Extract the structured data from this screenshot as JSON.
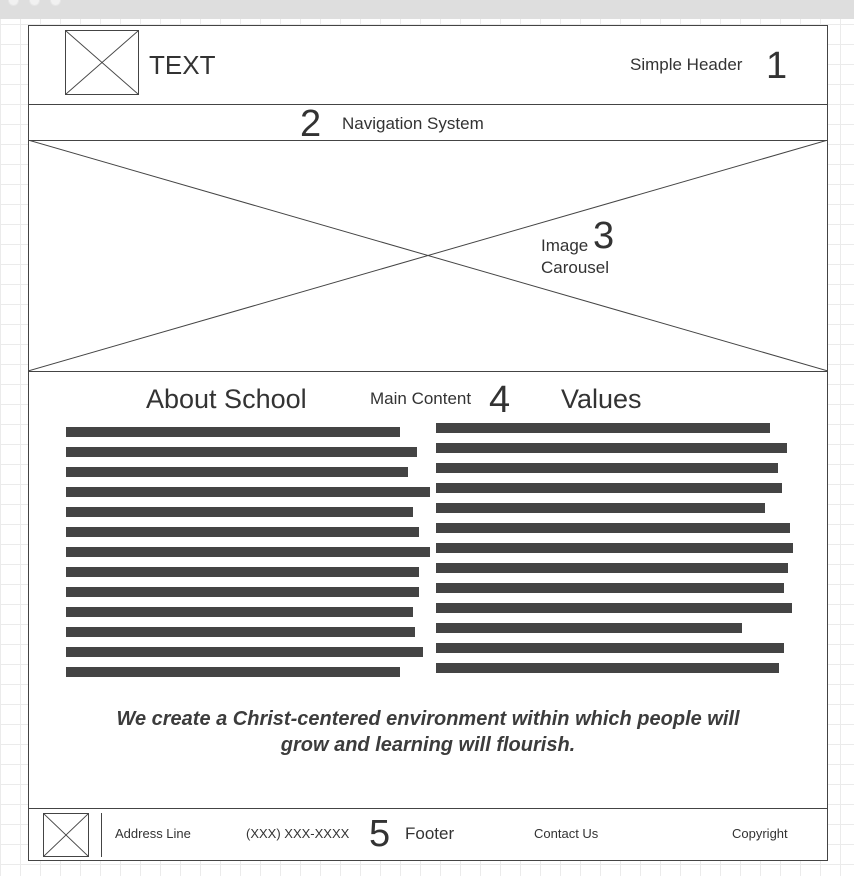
{
  "header": {
    "logo_text": "TEXT",
    "label": "Simple Header",
    "number": "1"
  },
  "navigation": {
    "number": "2",
    "label": "Navigation System"
  },
  "carousel": {
    "label_line1": "Image",
    "number": "3",
    "label_line2": "Carousel"
  },
  "main": {
    "left_heading": "About School",
    "center_label": "Main Content",
    "number": "4",
    "right_heading": "Values",
    "left_text_lines": 13,
    "right_text_lines": 13,
    "slogan_line1": "We create a Christ-centered environment within which people will",
    "slogan_line2": "grow and learning will flourish."
  },
  "footer": {
    "address": "Address Line",
    "phone": "(XXX) XXX-XXXX",
    "number": "5",
    "label": "Footer",
    "contact": "Contact Us",
    "copyright": "Copyright"
  },
  "colors": {
    "line": "#444444",
    "text": "#333333",
    "grid": "#ebebeb"
  }
}
